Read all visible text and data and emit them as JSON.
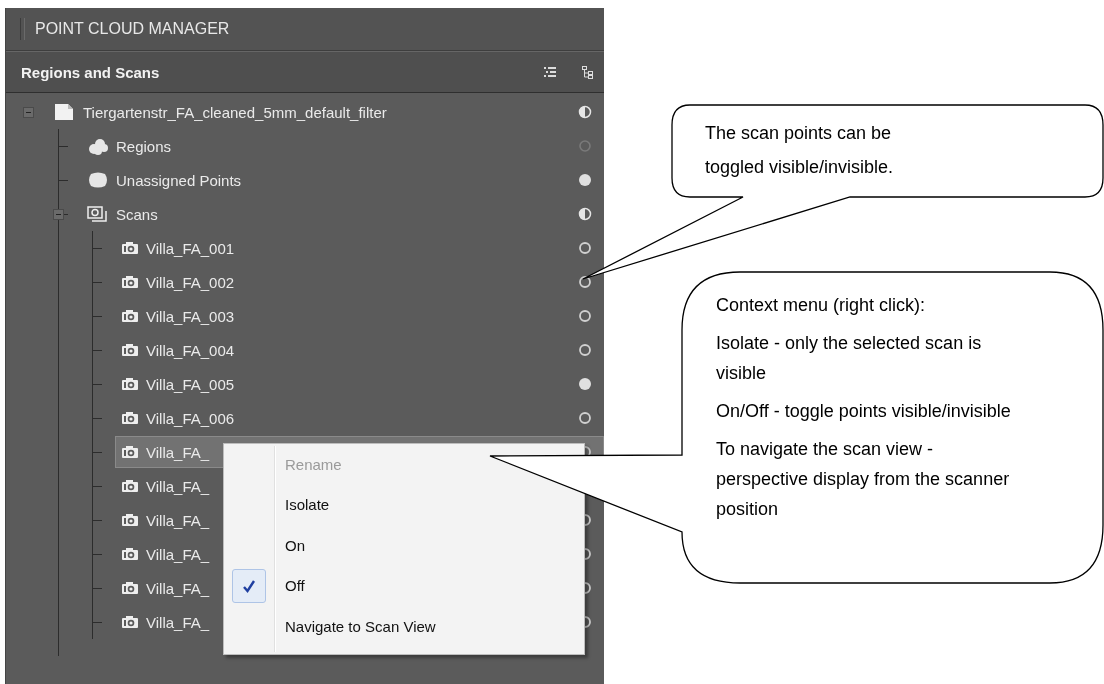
{
  "panel": {
    "title": "POINT CLOUD MANAGER",
    "section": {
      "title": "Regions and Scans"
    },
    "tree": [
      {
        "label": "Tiergartenstr_FA_cleaned_5mm_default_filter",
        "kind": "file",
        "toggle": {
          "kind": "half"
        },
        "expanded": true,
        "selected": false,
        "children": [
          {
            "label": "Regions",
            "kind": "regions",
            "toggle": {
              "kind": "inactive"
            },
            "selected": false
          },
          {
            "label": "Unassigned Points",
            "kind": "points",
            "toggle": {
              "kind": "full"
            },
            "selected": false
          },
          {
            "label": "Scans",
            "kind": "scans",
            "toggle": {
              "kind": "half"
            },
            "expanded": true,
            "selected": false,
            "children": [
              {
                "label": "Villa_FA_001",
                "kind": "scan",
                "toggle": {
                  "kind": "empty"
                },
                "selected": false
              },
              {
                "label": "Villa_FA_002",
                "kind": "scan",
                "toggle": {
                  "kind": "empty"
                },
                "selected": false
              },
              {
                "label": "Villa_FA_003",
                "kind": "scan",
                "toggle": {
                  "kind": "empty"
                },
                "selected": false
              },
              {
                "label": "Villa_FA_004",
                "kind": "scan",
                "toggle": {
                  "kind": "empty"
                },
                "selected": false
              },
              {
                "label": "Villa_FA_005",
                "kind": "scan",
                "toggle": {
                  "kind": "full"
                },
                "selected": false
              },
              {
                "label": "Villa_FA_006",
                "kind": "scan",
                "toggle": {
                  "kind": "empty"
                },
                "selected": false
              },
              {
                "label": "Villa_FA_",
                "kind": "scan",
                "toggle": {
                  "kind": "empty"
                },
                "selected": true
              },
              {
                "label": "Villa_FA_",
                "kind": "scan",
                "selected": false
              },
              {
                "label": "Villa_FA_",
                "kind": "scan",
                "toggle": {
                  "kind": "empty"
                },
                "selected": false
              },
              {
                "label": "Villa_FA_",
                "kind": "scan",
                "toggle": {
                  "kind": "empty"
                },
                "selected": false
              },
              {
                "label": "Villa_FA_",
                "kind": "scan",
                "toggle": {
                  "kind": "empty"
                },
                "selected": false
              },
              {
                "label": "Villa_FA_",
                "kind": "scan",
                "toggle": {
                  "kind": "empty"
                },
                "selected": false
              }
            ]
          }
        ]
      }
    ]
  },
  "context_menu": {
    "items": [
      {
        "label": "Rename",
        "disabled": true,
        "checked": false
      },
      {
        "label": "Isolate",
        "disabled": false,
        "checked": false
      },
      {
        "label": "On",
        "disabled": false,
        "checked": false
      },
      {
        "label": "Off",
        "disabled": false,
        "checked": true
      },
      {
        "label": "Navigate to Scan View",
        "disabled": false,
        "checked": false
      }
    ]
  },
  "callouts": [
    {
      "paragraphs": [
        "The scan points can be toggled visible/invisible."
      ]
    },
    {
      "paragraphs": [
        "Context menu (right click):",
        "Isolate - only the selected scan is visible",
        "On/Off - toggle points visible/invisible",
        "To navigate the scan view - perspective display from the scanner position"
      ]
    }
  ]
}
